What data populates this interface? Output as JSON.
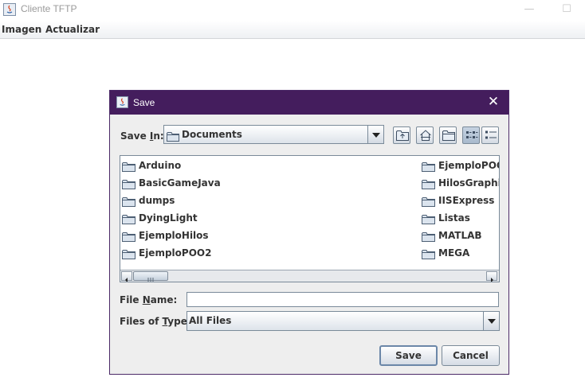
{
  "window": {
    "title": "Cliente TFTP",
    "controls": {
      "minimize": "—",
      "maximize": "☐"
    }
  },
  "menubar": {
    "items": [
      {
        "label": "Imagen"
      },
      {
        "label": "Actualizar"
      }
    ]
  },
  "dialog": {
    "title": "Save",
    "close_glyph": "✕",
    "save_in": {
      "label_pre": "Save ",
      "label_mnemonic": "I",
      "label_post": "n:",
      "value": "Documents"
    },
    "toolbar_icons": [
      "up-one-level-icon",
      "home-icon",
      "new-folder-icon",
      "list-view-icon",
      "details-view-icon"
    ],
    "files_left": [
      "Arduino",
      "BasicGameJava",
      "dumps",
      "DyingLight",
      "EjemploHilos",
      "EjemploPOO2"
    ],
    "files_right": [
      "EjemploPOOC",
      "HilosGraphics",
      "IISExpress",
      "Listas",
      "MATLAB",
      "MEGA"
    ],
    "file_name": {
      "label_pre": "File ",
      "label_mnemonic": "N",
      "label_post": "ame:",
      "value": ""
    },
    "file_type": {
      "label_pre": "Files of ",
      "label_mnemonic": "T",
      "label_post": "ype:",
      "value": "All Files"
    },
    "buttons": {
      "save": "Save",
      "cancel": "Cancel"
    }
  }
}
